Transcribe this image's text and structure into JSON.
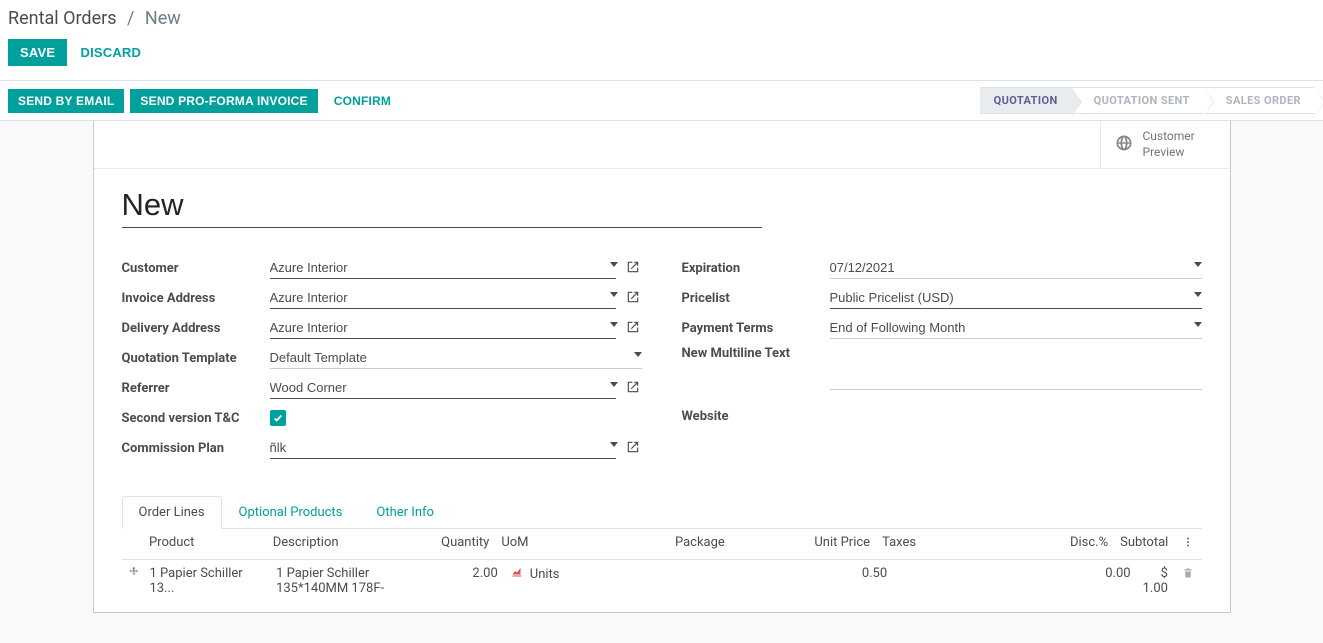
{
  "breadcrumb": {
    "root": "Rental Orders",
    "current": "New"
  },
  "actions": {
    "save": "SAVE",
    "discard": "DISCARD"
  },
  "toolbar": {
    "send_email": "SEND BY EMAIL",
    "send_proforma": "SEND PRO-FORMA INVOICE",
    "confirm": "CONFIRM"
  },
  "status": {
    "quotation": "QUOTATION",
    "quotation_sent": "QUOTATION SENT",
    "sales_order": "SALES ORDER"
  },
  "button_box": {
    "customer_preview_line1": "Customer",
    "customer_preview_line2": "Preview"
  },
  "title": "New",
  "fields": {
    "customer": {
      "label": "Customer",
      "value": "Azure Interior"
    },
    "invoice_address": {
      "label": "Invoice Address",
      "value": "Azure Interior"
    },
    "delivery_address": {
      "label": "Delivery Address",
      "value": "Azure Interior"
    },
    "quotation_template": {
      "label": "Quotation Template",
      "value": "Default Template"
    },
    "referrer": {
      "label": "Referrer",
      "value": "Wood Corner"
    },
    "second_tc": {
      "label": "Second version T&C",
      "checked": true
    },
    "commission_plan": {
      "label": "Commission Plan",
      "value": "ñlk"
    },
    "expiration": {
      "label": "Expiration",
      "value": "07/12/2021"
    },
    "pricelist": {
      "label": "Pricelist",
      "value": "Public Pricelist (USD)"
    },
    "payment_terms": {
      "label": "Payment Terms",
      "value": "End of Following Month"
    },
    "new_multiline": {
      "label": "New Multiline Text",
      "value": ""
    },
    "website": {
      "label": "Website",
      "value": ""
    }
  },
  "tabs": {
    "order_lines": "Order Lines",
    "optional_products": "Optional Products",
    "other_info": "Other Info"
  },
  "grid": {
    "headers": {
      "product": "Product",
      "description": "Description",
      "quantity": "Quantity",
      "uom": "UoM",
      "package": "Package",
      "unit_price": "Unit Price",
      "taxes": "Taxes",
      "disc": "Disc.%",
      "subtotal": "Subtotal"
    },
    "rows": [
      {
        "product": "1 Papier Schiller 13...",
        "description_l1": "1 Papier Schiller",
        "description_l2": "135*140MM 178F-",
        "quantity": "2.00",
        "uom": "Units",
        "package": "",
        "unit_price": "0.50",
        "taxes": "",
        "disc": "0.00",
        "subtotal": "$ 1.00"
      }
    ]
  }
}
